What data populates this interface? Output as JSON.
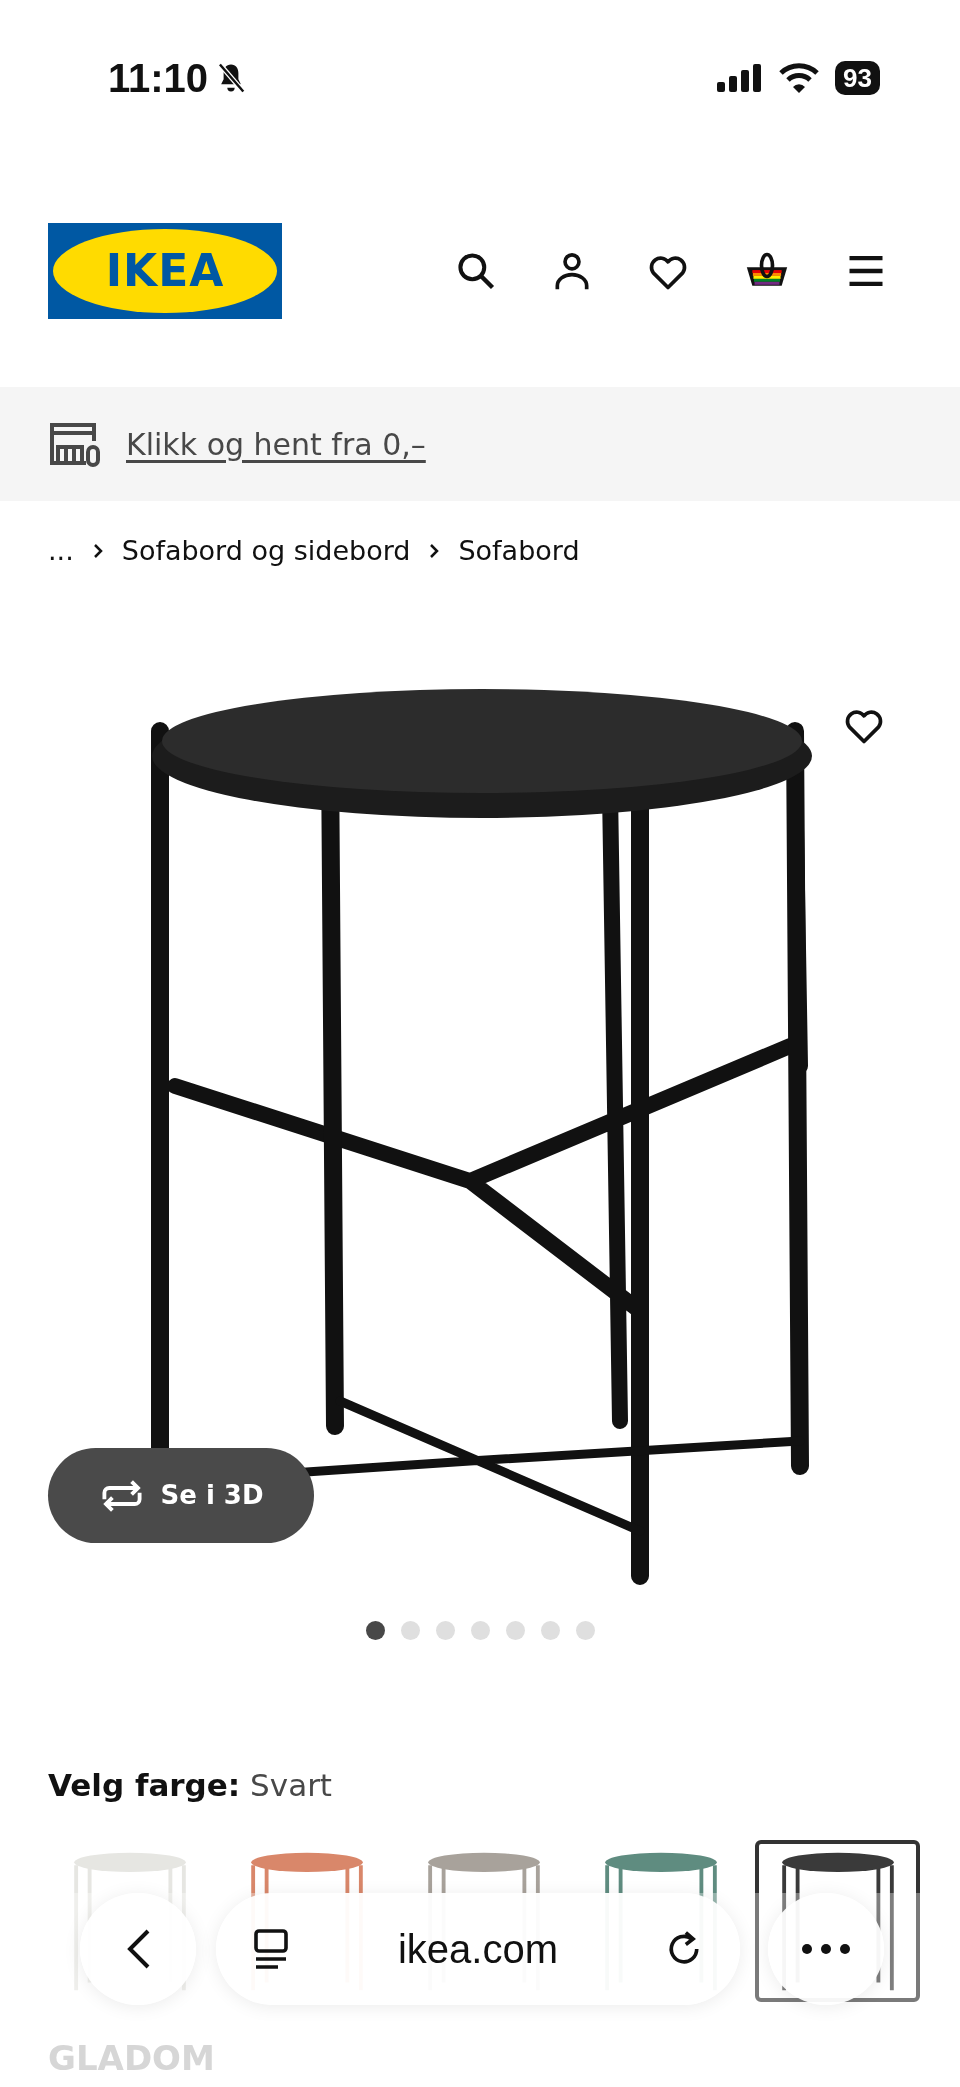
{
  "status_bar": {
    "time": "11:10",
    "battery": "93"
  },
  "header": {
    "logo": "IKEA"
  },
  "promo": {
    "link": "Klikk og hent fra 0,–"
  },
  "breadcrumbs": [
    {
      "label": "..."
    },
    {
      "label": "Sofabord og sidebord"
    },
    {
      "label": "Sofabord"
    }
  ],
  "gallery": {
    "view_3d": "Se i 3D",
    "dots": [
      {
        "selected": true
      },
      {
        "selected": false
      },
      {
        "selected": false
      },
      {
        "selected": false
      },
      {
        "selected": false
      },
      {
        "selected": false
      },
      {
        "selected": false
      }
    ]
  },
  "color_picker": {
    "label": "Velg farge:",
    "value": "Svart",
    "swatches": [
      {
        "color": "#e6e6e2",
        "selected": false
      },
      {
        "color": "#d9876a",
        "selected": false
      },
      {
        "color": "#a8a29b",
        "selected": false
      },
      {
        "color": "#5f8c80",
        "selected": false
      },
      {
        "color": "#3a3a3a",
        "selected": true
      }
    ]
  },
  "product_name": "GLADOM",
  "browser_bar": {
    "url": "ikea.com"
  }
}
